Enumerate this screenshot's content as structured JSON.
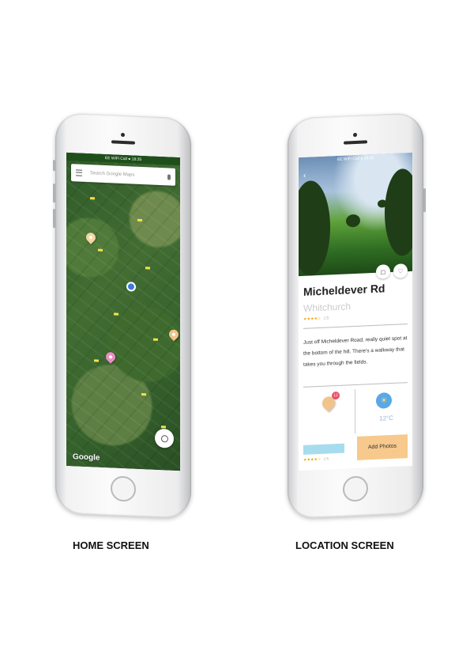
{
  "home": {
    "status": "EE WiFi Call  ●  18:35",
    "search_placeholder": "Search Google Maps",
    "map_logo": "Google",
    "caption": "HOME SCREEN"
  },
  "location": {
    "status": "EE WiFi Call  ●  18:35",
    "title": "Micheldever Rd",
    "subtitle": "Whitchurch",
    "rating_stars": "★★★★☆",
    "rating_count": "1/5",
    "description": "Just off Micheldever Road, really quiet spot at the bottom of the hill. There's a walkway that takes you through the fields.",
    "badge_count": "12",
    "temperature": "12°C",
    "small_rating": "★★★★☆",
    "small_rating_count": "1/5",
    "add_photos_label": "Add Photos",
    "caption": "LOCATION SCREEN"
  },
  "colors": {
    "pin_orange": "#f2c48b",
    "pin_pink": "#e98fc0",
    "pin_light": "#f4d6a0",
    "accent_blue": "#5aa7e6"
  }
}
